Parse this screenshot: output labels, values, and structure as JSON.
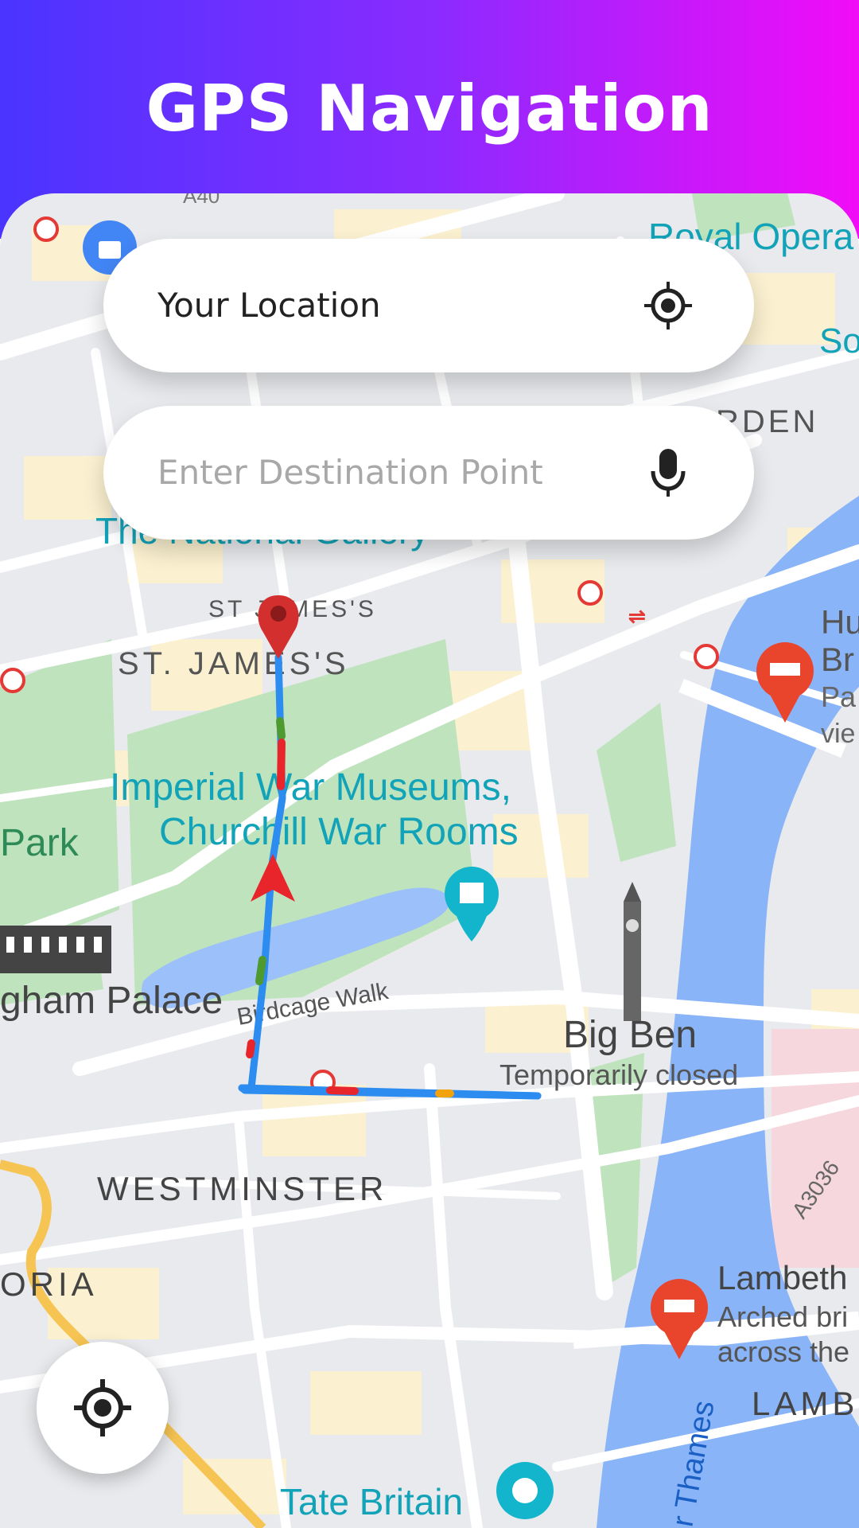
{
  "app": {
    "title": "GPS Navigation"
  },
  "search": {
    "origin_value": "Your Location",
    "destination_placeholder": "Enter Destination Point"
  },
  "map": {
    "labels": {
      "a40": "A40",
      "royal_opera": "Royal Opera",
      "so": "So",
      "garden": "RDEN",
      "national_gallery": "The National Gallery",
      "st_james_small": "ST JAMES'S",
      "st_james": "ST. JAMES'S",
      "hu": "Hu",
      "br": "Br",
      "pa": "Pa",
      "vie": "vie",
      "iwm_1": "Imperial War Museums,",
      "iwm_2": "Churchill War Rooms",
      "park": "Park",
      "palace": "gham Palace",
      "birdcage": "Birdcage Walk",
      "big_ben": "Big Ben",
      "big_ben_status": "Temporarily closed",
      "westminster": "WESTMINSTER",
      "a3036": "A3036",
      "oria": "ORIA",
      "lambeth": "Lambeth",
      "lambeth_desc_1": "Arched bri",
      "lambeth_desc_2": "across the",
      "lambe": "LAMBE",
      "thames": "r Thames",
      "tate": "Tate Britain"
    }
  },
  "colors": {
    "header_start": "#4a34ff",
    "header_end": "#f20cf7",
    "route": "#2d8cf0",
    "route_traffic_heavy": "#e8252a",
    "route_traffic_light": "#4e9a2f",
    "route_traffic_medium": "#f2a20b",
    "river": "#8ab4f8",
    "park": "#b6e0b4",
    "poi_teal": "#12b5cb",
    "poi_red": "#e8452c"
  },
  "icons": {
    "origin": "crosshair-icon",
    "destination": "microphone-icon",
    "recenter": "crosshair-icon"
  }
}
